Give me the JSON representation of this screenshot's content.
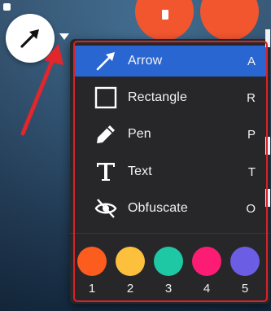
{
  "menu": {
    "items": [
      {
        "label": "Arrow",
        "key": "A",
        "icon": "arrow-icon"
      },
      {
        "label": "Rectangle",
        "key": "R",
        "icon": "rectangle-icon"
      },
      {
        "label": "Pen",
        "key": "P",
        "icon": "pen-icon"
      },
      {
        "label": "Text",
        "key": "T",
        "icon": "text-icon"
      },
      {
        "label": "Obfuscate",
        "key": "O",
        "icon": "obfuscate-icon"
      }
    ],
    "active_item": "Arrow"
  },
  "colors": [
    {
      "label": "1",
      "hex": "#fd5c1f"
    },
    {
      "label": "2",
      "hex": "#fcc03d"
    },
    {
      "label": "3",
      "hex": "#1ec8a5"
    },
    {
      "label": "4",
      "hex": "#fd1c73"
    },
    {
      "label": "5",
      "hex": "#6b5de4"
    }
  ],
  "theme": {
    "menu_bg": "#27272a",
    "active_bg": "#2a66d1",
    "callout_red": "#d8232a",
    "action_button": "#f2562f"
  }
}
